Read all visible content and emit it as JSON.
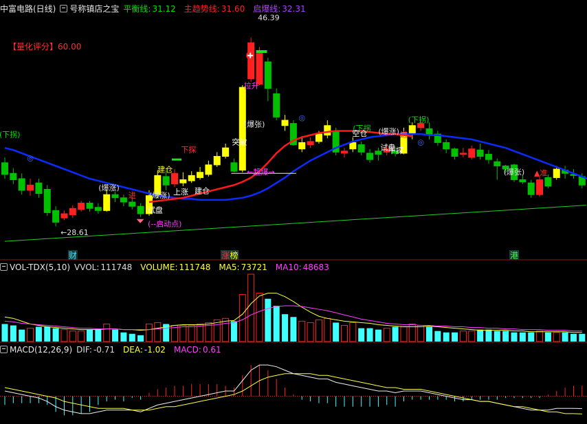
{
  "header": {
    "stock": "中富电路(日线)",
    "indicator_name": "号称镇店之宝",
    "lines": [
      {
        "label": "平衡线:",
        "value": "31.12",
        "color": "#00e000"
      },
      {
        "label": "主趋势线:",
        "value": "31.60",
        "color": "#ff2020"
      },
      {
        "label": "启爆线:",
        "value": "32.31",
        "color": "#b040ff"
      }
    ]
  },
  "score": {
    "label": "【量化评分】",
    "value": "60.00"
  },
  "vol_header": {
    "name": "VOL-TDX(5,10)",
    "items": [
      {
        "label": "VVOL:",
        "value": "111748",
        "color": "#dddddd"
      },
      {
        "label": "VOLUME:",
        "value": "111748",
        "color": "#ffff40"
      },
      {
        "label": "MA5:",
        "value": "73721",
        "color": "#ffff40"
      },
      {
        "label": "MA10:",
        "value": "48683",
        "color": "#ff40ff"
      }
    ]
  },
  "macd_header": {
    "name": "MACD(12,26,9)",
    "items": [
      {
        "label": "DIF:",
        "value": "-0.71",
        "color": "#dddddd"
      },
      {
        "label": "DEA:",
        "value": "-1.02",
        "color": "#ffff40"
      },
      {
        "label": "MACD:",
        "value": "0.61",
        "color": "#ff40ff"
      }
    ]
  },
  "colors": {
    "up": "#ff2020",
    "down": "#00c000",
    "signal": "#ffff00",
    "trend": "#0a2cff",
    "ma_green": "#20d020",
    "vol_down": "#40ffff"
  },
  "chart_data": {
    "type": "candlestick",
    "ylim": [
      26.5,
      48.5
    ],
    "high_annotation": "46.39",
    "low_annotation": "28.61",
    "candles": [
      {
        "o": 34.6,
        "c": 33.5,
        "h": 35.1,
        "l": 33.1
      },
      {
        "o": 33.6,
        "c": 33.0,
        "h": 34.1,
        "l": 32.6
      },
      {
        "o": 33.1,
        "c": 32.0,
        "h": 33.6,
        "l": 31.6
      },
      {
        "o": 32.0,
        "c": 32.5,
        "h": 33.1,
        "l": 31.5
      },
      {
        "o": 32.7,
        "c": 31.7,
        "h": 33.1,
        "l": 31.3
      },
      {
        "o": 32.1,
        "c": 29.9,
        "h": 32.5,
        "l": 29.6
      },
      {
        "o": 30.1,
        "c": 29.0,
        "h": 30.5,
        "l": 28.61
      },
      {
        "o": 29.4,
        "c": 29.8,
        "h": 30.1,
        "l": 29.2
      },
      {
        "o": 29.7,
        "c": 30.3,
        "h": 30.6,
        "l": 29.4
      },
      {
        "o": 30.2,
        "c": 30.8,
        "h": 31.0,
        "l": 30.0
      },
      {
        "o": 30.8,
        "c": 30.3,
        "h": 31.0,
        "l": 30.0
      },
      {
        "o": 30.4,
        "c": 30.1,
        "h": 30.8,
        "l": 29.8
      },
      {
        "o": 30.1,
        "c": 31.6,
        "h": 32.0,
        "l": 30.0,
        "sig": true
      },
      {
        "o": 31.6,
        "c": 31.3,
        "h": 31.9,
        "l": 30.9
      },
      {
        "o": 31.3,
        "c": 30.9,
        "h": 31.6,
        "l": 30.5
      },
      {
        "o": 30.9,
        "c": 30.5,
        "h": 31.4,
        "l": 30.2
      },
      {
        "o": 30.5,
        "c": 29.8,
        "h": 30.8,
        "l": 29.5
      },
      {
        "o": 29.8,
        "c": 31.5,
        "h": 32.0,
        "l": 29.6,
        "sig": true
      },
      {
        "o": 31.5,
        "c": 33.4,
        "h": 33.9,
        "l": 31.3,
        "sig": true
      },
      {
        "o": 33.3,
        "c": 32.5,
        "h": 33.9,
        "l": 32.0
      },
      {
        "o": 32.6,
        "c": 33.6,
        "h": 34.0,
        "l": 32.3
      },
      {
        "o": 32.7,
        "c": 33.0,
        "h": 33.7,
        "l": 32.4,
        "sig": true
      },
      {
        "o": 32.9,
        "c": 33.4,
        "h": 33.8,
        "l": 32.7,
        "sig": true
      },
      {
        "o": 33.2,
        "c": 33.7,
        "h": 34.2,
        "l": 33.0,
        "sig": true
      },
      {
        "o": 33.5,
        "c": 34.4,
        "h": 34.8,
        "l": 33.3,
        "sig": true
      },
      {
        "o": 34.4,
        "c": 35.2,
        "h": 35.6,
        "l": 34.2,
        "sig": true
      },
      {
        "o": 35.2,
        "c": 36.0,
        "h": 36.4,
        "l": 35.0,
        "sig": true
      },
      {
        "o": 34.6,
        "c": 33.8,
        "h": 35.0,
        "l": 33.7
      },
      {
        "o": 33.9,
        "c": 41.7,
        "h": 41.9,
        "l": 33.7,
        "sig": true
      },
      {
        "o": 42.5,
        "c": 45.9,
        "h": 46.39,
        "l": 42.2
      },
      {
        "o": 42.0,
        "c": 44.9,
        "h": 45.5,
        "l": 41.9
      },
      {
        "o": 44.1,
        "c": 41.6,
        "h": 44.5,
        "l": 40.4
      },
      {
        "o": 41.1,
        "c": 38.9,
        "h": 41.6,
        "l": 38.6
      },
      {
        "o": 38.6,
        "c": 38.1,
        "h": 39.1,
        "l": 37.6,
        "sig": true
      },
      {
        "o": 38.3,
        "c": 36.3,
        "h": 38.6,
        "l": 36.2
      },
      {
        "o": 35.9,
        "c": 36.5,
        "h": 37.1,
        "l": 35.6,
        "sig": true
      },
      {
        "o": 36.3,
        "c": 36.6,
        "h": 37.0,
        "l": 36.0
      },
      {
        "o": 36.6,
        "c": 37.3,
        "h": 37.6,
        "l": 36.4,
        "sig": true
      },
      {
        "o": 37.2,
        "c": 38.1,
        "h": 38.6,
        "l": 36.9,
        "sig": true
      },
      {
        "o": 37.6,
        "c": 35.6,
        "h": 37.9,
        "l": 35.3
      },
      {
        "o": 35.5,
        "c": 35.7,
        "h": 36.0,
        "l": 35.1
      },
      {
        "o": 35.9,
        "c": 36.5,
        "h": 37.0,
        "l": 35.6,
        "sig": true
      },
      {
        "o": 36.3,
        "c": 35.6,
        "h": 36.6,
        "l": 35.3
      },
      {
        "o": 35.5,
        "c": 34.9,
        "h": 35.9,
        "l": 34.6
      },
      {
        "o": 35.7,
        "c": 35.4,
        "h": 36.0,
        "l": 34.8
      },
      {
        "o": 35.6,
        "c": 35.9,
        "h": 36.2,
        "l": 35.3
      },
      {
        "o": 35.7,
        "c": 35.5,
        "h": 36.0,
        "l": 35.2
      },
      {
        "o": 35.5,
        "c": 37.4,
        "h": 37.9,
        "l": 35.4,
        "sig": true
      },
      {
        "o": 37.3,
        "c": 38.1,
        "h": 38.4,
        "l": 36.8,
        "sig": true
      },
      {
        "o": 37.9,
        "c": 38.3,
        "h": 38.7,
        "l": 37.6
      },
      {
        "o": 37.8,
        "c": 37.3,
        "h": 38.4,
        "l": 36.8
      },
      {
        "o": 37.3,
        "c": 36.5,
        "h": 37.6,
        "l": 36.2
      },
      {
        "o": 36.5,
        "c": 35.9,
        "h": 36.8,
        "l": 35.5
      },
      {
        "o": 35.9,
        "c": 35.2,
        "h": 36.0,
        "l": 34.9
      },
      {
        "o": 35.4,
        "c": 35.5,
        "h": 36.0,
        "l": 35.1
      },
      {
        "o": 35.1,
        "c": 35.9,
        "h": 36.2,
        "l": 34.9
      },
      {
        "o": 35.8,
        "c": 35.2,
        "h": 36.4,
        "l": 34.9
      },
      {
        "o": 35.4,
        "c": 34.9,
        "h": 35.8,
        "l": 34.5
      },
      {
        "o": 34.7,
        "c": 34.3,
        "h": 35.0,
        "l": 33.0
      },
      {
        "o": 34.3,
        "c": 34.0,
        "h": 34.4,
        "l": 33.6
      },
      {
        "o": 34.4,
        "c": 33.0,
        "h": 34.5,
        "l": 32.8
      },
      {
        "o": 33.0,
        "c": 32.8,
        "h": 33.4,
        "l": 32.6
      },
      {
        "o": 32.7,
        "c": 31.6,
        "h": 33.0,
        "l": 31.3
      },
      {
        "o": 31.6,
        "c": 33.0,
        "h": 33.3,
        "l": 31.4
      },
      {
        "o": 33.2,
        "c": 32.4,
        "h": 33.5,
        "l": 32.2
      },
      {
        "o": 33.2,
        "c": 34.0,
        "h": 34.3,
        "l": 33.0,
        "sig": true
      },
      {
        "o": 33.9,
        "c": 33.6,
        "h": 34.3,
        "l": 33.1
      },
      {
        "o": 33.5,
        "c": 33.4,
        "h": 34.0,
        "l": 33.1
      },
      {
        "o": 33.3,
        "c": 32.5,
        "h": 33.6,
        "l": 32.2
      }
    ],
    "blue_trend": [
      36.0,
      35.8,
      35.5,
      35.2,
      34.9,
      34.6,
      34.3,
      34.0,
      33.7,
      33.4,
      33.1,
      32.9,
      32.7,
      32.5,
      32.3,
      32.1,
      31.9,
      31.7,
      31.5,
      31.4,
      31.3,
      31.2,
      31.2,
      31.1,
      31.1,
      31.1,
      31.1,
      31.2,
      31.3,
      31.5,
      31.8,
      32.2,
      32.7,
      33.2,
      33.8,
      34.3,
      34.8,
      35.2,
      35.6,
      36.0,
      36.3,
      36.6,
      36.8,
      37.0,
      37.1,
      37.2,
      37.3,
      37.3,
      37.3,
      37.3,
      37.2,
      37.2,
      37.1,
      37.0,
      36.9,
      36.8,
      36.6,
      36.4,
      36.2,
      36.0,
      35.7,
      35.4,
      35.1,
      34.8,
      34.5,
      34.2,
      33.9,
      33.6,
      33.3
    ],
    "red_trend": {
      "start": 17,
      "values": [
        30.9,
        31.0,
        31.1,
        31.2,
        31.3,
        31.5,
        31.7,
        31.9,
        32.1,
        32.3,
        32.5,
        32.8,
        33.2,
        33.8,
        34.6,
        35.5,
        36.2,
        36.7,
        37.0,
        37.2,
        37.4,
        37.5,
        37.6,
        37.6,
        37.6,
        37.6,
        37.5,
        37.4,
        37.3,
        37.3,
        37.2,
        37.1
      ]
    },
    "green_ma": {
      "from": 27.2,
      "to": 30.6
    },
    "volume": [
      0.26,
      0.24,
      0.18,
      0.2,
      0.22,
      0.22,
      0.2,
      0.18,
      0.16,
      0.16,
      0.18,
      0.18,
      0.26,
      0.18,
      0.14,
      0.12,
      0.1,
      0.26,
      0.28,
      0.26,
      0.24,
      0.24,
      0.24,
      0.26,
      0.28,
      0.32,
      0.34,
      0.3,
      0.68,
      0.97,
      0.7,
      0.62,
      0.52,
      0.4,
      0.36,
      0.3,
      0.28,
      0.32,
      0.34,
      0.28,
      0.24,
      0.28,
      0.2,
      0.2,
      0.18,
      0.2,
      0.22,
      0.22,
      0.26,
      0.24,
      0.22,
      0.16,
      0.14,
      0.14,
      0.16,
      0.16,
      0.18,
      0.18,
      0.16,
      0.16,
      0.14,
      0.14,
      0.14,
      0.16,
      0.14,
      0.14,
      0.14,
      0.12,
      0.12
    ],
    "vol_ma5": [
      0.36,
      0.34,
      0.3,
      0.26,
      0.24,
      0.22,
      0.21,
      0.2,
      0.19,
      0.18,
      0.18,
      0.18,
      0.19,
      0.19,
      0.18,
      0.18,
      0.17,
      0.18,
      0.2,
      0.22,
      0.24,
      0.25,
      0.25,
      0.25,
      0.26,
      0.28,
      0.3,
      0.31,
      0.4,
      0.55,
      0.66,
      0.7,
      0.7,
      0.65,
      0.58,
      0.5,
      0.43,
      0.37,
      0.34,
      0.32,
      0.3,
      0.29,
      0.28,
      0.27,
      0.25,
      0.24,
      0.23,
      0.22,
      0.22,
      0.22,
      0.23,
      0.22,
      0.21,
      0.2,
      0.19,
      0.18,
      0.17,
      0.17,
      0.17,
      0.17,
      0.16,
      0.16,
      0.15,
      0.15,
      0.15,
      0.15,
      0.15,
      0.14,
      0.14
    ],
    "vol_ma10": [
      0.3,
      0.29,
      0.27,
      0.26,
      0.25,
      0.24,
      0.23,
      0.22,
      0.21,
      0.2,
      0.2,
      0.19,
      0.19,
      0.19,
      0.18,
      0.18,
      0.18,
      0.18,
      0.19,
      0.2,
      0.21,
      0.22,
      0.22,
      0.23,
      0.24,
      0.25,
      0.27,
      0.28,
      0.32,
      0.39,
      0.44,
      0.48,
      0.51,
      0.52,
      0.52,
      0.51,
      0.49,
      0.47,
      0.45,
      0.42,
      0.39,
      0.36,
      0.33,
      0.31,
      0.29,
      0.27,
      0.26,
      0.25,
      0.25,
      0.24,
      0.24,
      0.23,
      0.23,
      0.22,
      0.22,
      0.21,
      0.21,
      0.2,
      0.2,
      0.19,
      0.19,
      0.18,
      0.18,
      0.18,
      0.17,
      0.17,
      0.17,
      0.16,
      0.16
    ],
    "macd_ylim": [
      -1.6,
      2.4
    ],
    "dif": [
      0.3,
      0.2,
      0.1,
      0.0,
      -0.1,
      -0.3,
      -0.6,
      -0.8,
      -0.9,
      -1.0,
      -1.0,
      -0.9,
      -0.8,
      -0.8,
      -0.8,
      -0.8,
      -0.9,
      -0.7,
      -0.5,
      -0.4,
      -0.3,
      -0.2,
      -0.1,
      0.0,
      0.1,
      0.2,
      0.3,
      0.3,
      0.9,
      1.5,
      1.8,
      1.8,
      1.7,
      1.5,
      1.3,
      1.2,
      1.1,
      1.0,
      1.0,
      0.8,
      0.7,
      0.6,
      0.5,
      0.4,
      0.3,
      0.3,
      0.2,
      0.3,
      0.3,
      0.3,
      0.2,
      0.1,
      0.0,
      -0.1,
      -0.2,
      -0.2,
      -0.3,
      -0.3,
      -0.4,
      -0.5,
      -0.6,
      -0.7,
      -0.8,
      -0.8,
      -0.8,
      -0.7,
      -0.7,
      -0.7,
      -0.71
    ],
    "dea": [
      0.5,
      0.4,
      0.3,
      0.2,
      0.1,
      0.0,
      -0.1,
      -0.3,
      -0.4,
      -0.5,
      -0.6,
      -0.7,
      -0.7,
      -0.7,
      -0.7,
      -0.8,
      -0.8,
      -0.8,
      -0.7,
      -0.6,
      -0.6,
      -0.5,
      -0.4,
      -0.3,
      -0.2,
      -0.1,
      0.0,
      0.1,
      0.3,
      0.6,
      0.9,
      1.1,
      1.2,
      1.3,
      1.3,
      1.3,
      1.3,
      1.2,
      1.2,
      1.1,
      1.0,
      0.9,
      0.8,
      0.7,
      0.6,
      0.5,
      0.5,
      0.4,
      0.4,
      0.4,
      0.3,
      0.2,
      0.1,
      0.0,
      -0.1,
      -0.2,
      -0.3,
      -0.3,
      -0.4,
      -0.5,
      -0.6,
      -0.6,
      -0.7,
      -0.8,
      -0.9,
      -0.9,
      -1.0,
      -1.0,
      -1.02
    ],
    "macd": [
      -0.5,
      -0.4,
      -0.4,
      -0.4,
      -0.4,
      -0.5,
      -0.9,
      -1.1,
      -1.1,
      -1.0,
      -0.9,
      -0.5,
      -0.3,
      -0.2,
      -0.3,
      -0.1,
      -0.2,
      0.2,
      0.4,
      0.5,
      0.6,
      0.6,
      0.7,
      0.7,
      0.7,
      0.7,
      0.6,
      0.5,
      1.2,
      1.8,
      1.8,
      1.5,
      1.0,
      0.5,
      0.1,
      -0.2,
      -0.3,
      -0.4,
      -0.4,
      -0.6,
      -0.6,
      -0.6,
      -0.6,
      -0.6,
      -0.6,
      -0.5,
      -0.6,
      -0.3,
      -0.2,
      -0.2,
      -0.2,
      -0.2,
      -0.2,
      -0.3,
      -0.3,
      -0.2,
      -0.2,
      -0.2,
      -0.2,
      -0.1,
      -0.1,
      -0.1,
      -0.1,
      -0.1,
      0.1,
      0.3,
      0.5,
      0.6,
      0.61
    ],
    "annotations": [
      {
        "i": 0,
        "price": 37.0,
        "text": "(下拐)",
        "color": "#00e000",
        "align": "start",
        "dx": -8
      },
      {
        "i": 3,
        "price": 34.8,
        "text": "◎",
        "color": "#3a6aff",
        "align": "middle"
      },
      {
        "i": 12,
        "price": 32.0,
        "text": "(爆涨)",
        "color": "#e0e0e0",
        "align": "start",
        "dx": -12
      },
      {
        "i": 15,
        "price": 31.3,
        "text": "进",
        "color": "#ff3030",
        "align": "middle"
      },
      {
        "i": 17,
        "price": 31.3,
        "text": "(爆涨)",
        "color": "#e0e0e0",
        "align": "start",
        "dx": 0
      },
      {
        "i": 17,
        "price": 29.9,
        "text": "试盘",
        "color": "#ffffff",
        "align": "start",
        "dx": -2
      },
      {
        "i": 17,
        "price": 28.6,
        "text": "(--启动点)",
        "color": "#ff40ff",
        "align": "start",
        "dx": -2
      },
      {
        "i": 18,
        "price": 33.7,
        "text": "建仓",
        "color": "#ffff00",
        "align": "start",
        "dx": 0
      },
      {
        "i": 20,
        "price": 31.6,
        "text": "上涨",
        "color": "#ffffff",
        "align": "start",
        "dx": -2
      },
      {
        "i": 21,
        "price": 35.6,
        "text": "下探",
        "color": "#ff3030",
        "align": "start",
        "dx": -3
      },
      {
        "i": 23,
        "price": 31.7,
        "text": "建仓",
        "color": "#ffffff",
        "align": "start",
        "dx": -8
      },
      {
        "i": 27,
        "price": 36.3,
        "text": "突破",
        "color": "#ffffff",
        "align": "start",
        "dx": -3
      },
      {
        "i": 28,
        "price": 41.6,
        "text": "拉升",
        "color": "#ff40ff",
        "align": "start",
        "dx": 2
      },
      {
        "i": 28,
        "price": 38.0,
        "text": "(爆张)",
        "color": "#e0e0e0",
        "align": "start",
        "dx": 2
      },
      {
        "i": 29,
        "price": 33.5,
        "text": "←超爆→",
        "color": "#ff40ff",
        "align": "start",
        "dx": -6
      },
      {
        "i": 29,
        "price": 48.0,
        "text": "46.39",
        "color": "#e0e0e0",
        "align": "start",
        "dx": 10
      },
      {
        "i": 6,
        "price": 27.8,
        "text": "←28.61",
        "color": "#e0e0e0",
        "align": "start",
        "dx": 7
      },
      {
        "i": 35,
        "price": 38.6,
        "text": "◎",
        "color": "#3a6aff",
        "align": "middle"
      },
      {
        "i": 41,
        "price": 37.6,
        "text": "(下拐",
        "color": "#00e000",
        "align": "start",
        "dx": 0
      },
      {
        "i": 41,
        "price": 37.1,
        "text": "空仓",
        "color": "#ffffff",
        "align": "start",
        "dx": -1
      },
      {
        "i": 44,
        "price": 37.3,
        "text": "(爆涨)",
        "color": "#e0e0e0",
        "align": "start",
        "dx": 0
      },
      {
        "i": 44,
        "price": 35.8,
        "text": "试盘",
        "color": "#ffffff",
        "align": "start",
        "dx": 3
      },
      {
        "i": 45,
        "price": 35.5,
        "text": "下探",
        "color": "#ffffff",
        "align": "start",
        "dx": 2
      },
      {
        "i": 47,
        "price": 37.0,
        "text": "进",
        "color": "#ff3030",
        "align": "middle"
      },
      {
        "i": 48,
        "price": 38.4,
        "text": "(下拐)",
        "color": "#00e000",
        "align": "start",
        "dx": -6
      },
      {
        "i": 49,
        "price": 36.3,
        "text": "◎",
        "color": "#3a6aff",
        "align": "middle"
      },
      {
        "i": 59,
        "price": 33.5,
        "text": "(爆张)",
        "color": "#e0e0e0",
        "align": "start",
        "dx": -3
      },
      {
        "i": 63,
        "price": 33.4,
        "text": "▲准",
        "color": "#ff3030",
        "align": "start",
        "dx": -8
      }
    ],
    "bottom_labels": [
      {
        "i": 8,
        "text": "财",
        "color": "#40e0ff"
      },
      {
        "i": 26,
        "text": "涨",
        "color": "#ff3030"
      },
      {
        "i": 27,
        "text": "榜",
        "color": "#ffff00"
      },
      {
        "i": 60,
        "text": "港",
        "color": "#40ff40"
      }
    ]
  }
}
